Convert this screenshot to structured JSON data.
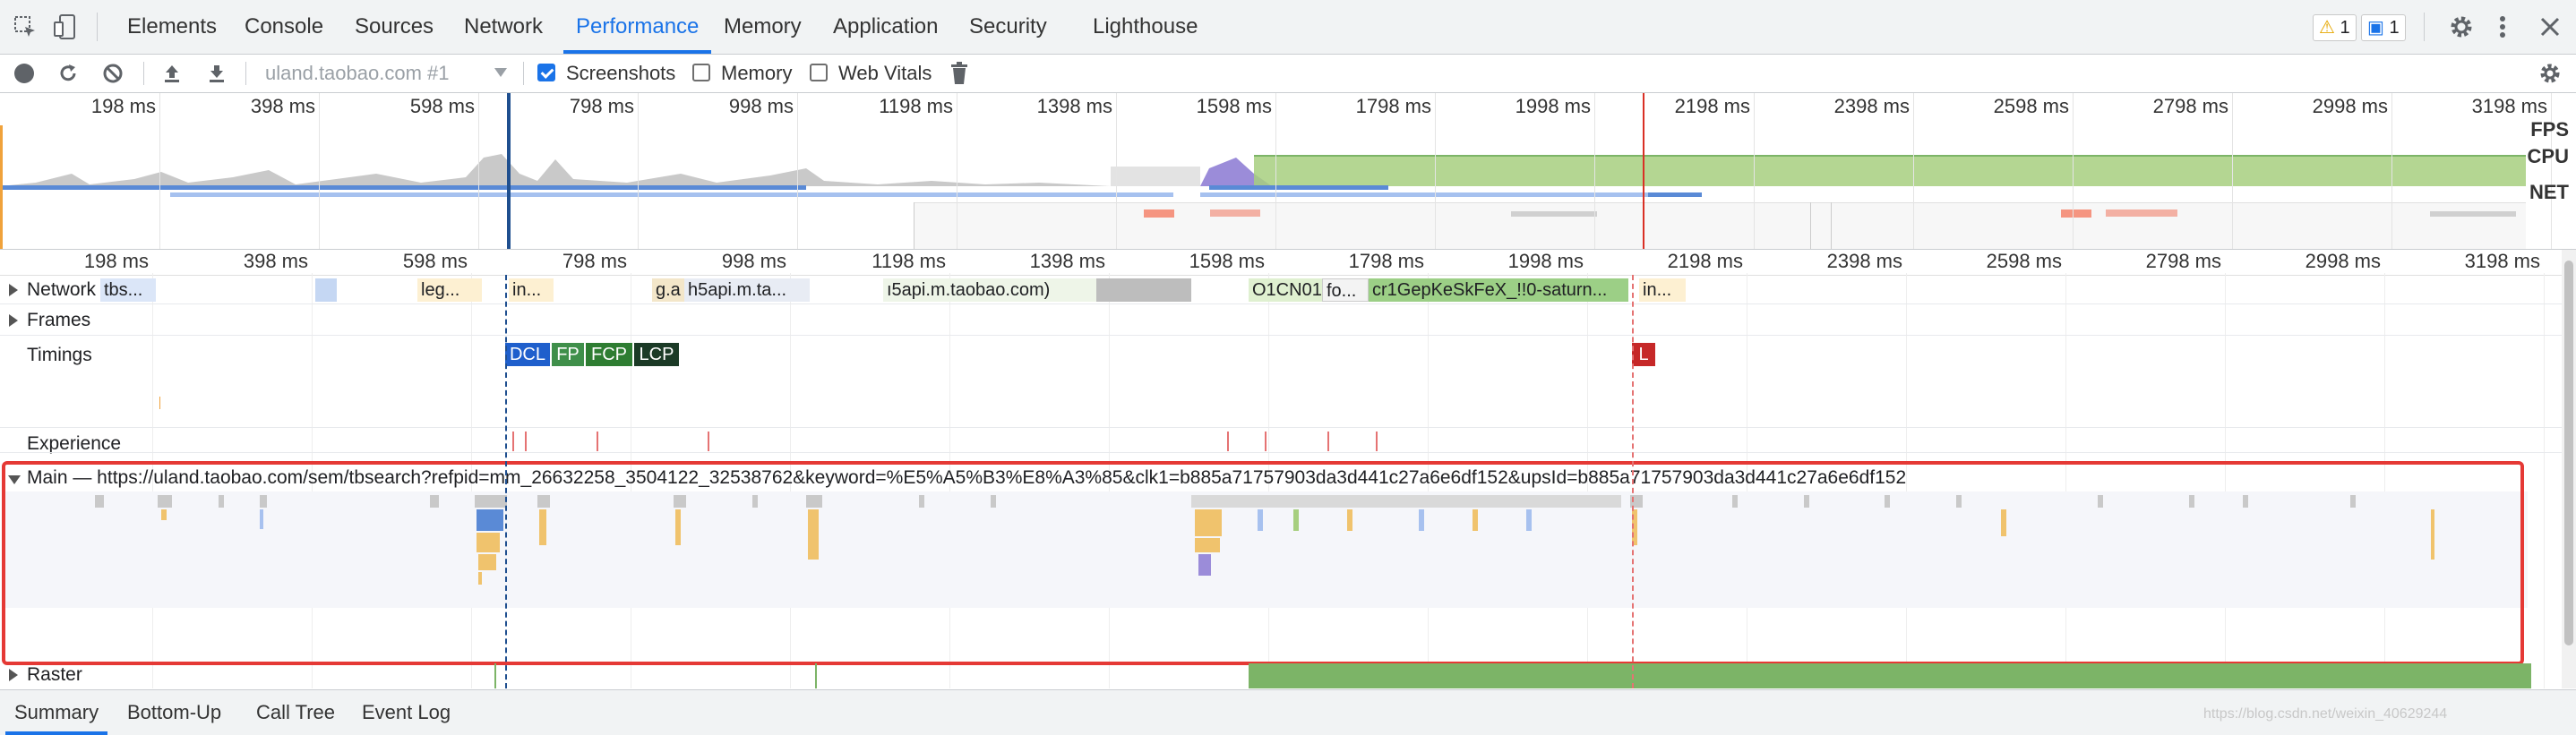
{
  "tabs": [
    "Elements",
    "Console",
    "Sources",
    "Network",
    "Performance",
    "Memory",
    "Application",
    "Security",
    "Lighthouse"
  ],
  "active_tab": "Performance",
  "badges": {
    "warnings": "1",
    "messages": "1"
  },
  "toolbar": {
    "profile_select": "uland.taobao.com #1",
    "screenshots_label": "Screenshots",
    "memory_label": "Memory",
    "web_vitals_label": "Web Vitals"
  },
  "overview_ticks": [
    "198 ms",
    "398 ms",
    "598 ms",
    "798 ms",
    "998 ms",
    "1198 ms",
    "1398 ms",
    "1598 ms",
    "1798 ms",
    "1998 ms",
    "2198 ms",
    "2398 ms",
    "2598 ms",
    "2798 ms",
    "2998 ms",
    "3198 ms"
  ],
  "overview_labels": {
    "fps": "FPS",
    "cpu": "CPU",
    "net": "NET"
  },
  "timeline_ticks": [
    "198 ms",
    "398 ms",
    "598 ms",
    "798 ms",
    "998 ms",
    "1198 ms",
    "1398 ms",
    "1598 ms",
    "1798 ms",
    "1998 ms",
    "2198 ms",
    "2398 ms",
    "2598 ms",
    "2798 ms",
    "2998 ms",
    "3198 ms"
  ],
  "tracks": {
    "network": "Network",
    "frames": "Frames",
    "timings": "Timings",
    "experience": "Experience",
    "main": "Main — https://uland.taobao.com/sem/tbsearch?refpid=mm_26632258_3504122_32538762&keyword=%E5%A5%B3%E8%A3%85&clk1=b885a71757903da3d441c27a6e6df152&upsId=b885a71757903da3d441c27a6e6df152",
    "raster": "Raster"
  },
  "network_items": [
    "tbs...",
    "leg...",
    "in...",
    "g.a",
    "h5api.m.ta...",
    "ı5api.m.taobao.com)",
    "O1CN01",
    "fo...",
    "cr1GepKeSkFeX_!!0-saturn...",
    "in..."
  ],
  "timing_marks": [
    "DCL",
    "FP",
    "FCP",
    "LCP",
    "L"
  ],
  "bottom_tabs": [
    "Summary",
    "Bottom-Up",
    "Call Tree",
    "Event Log"
  ],
  "active_bottom_tab": "Summary",
  "watermark": "https://blog.csdn.net/weixin_40629244",
  "colors": {
    "accent": "#1a73e8",
    "highlight_box": "#e53935",
    "dcl": "#1f5fcc",
    "fp": "#3f8f4a",
    "fcp": "#2e7d32",
    "lcp": "#1b3a26",
    "load": "#c62828",
    "raster": "#7cb467"
  }
}
